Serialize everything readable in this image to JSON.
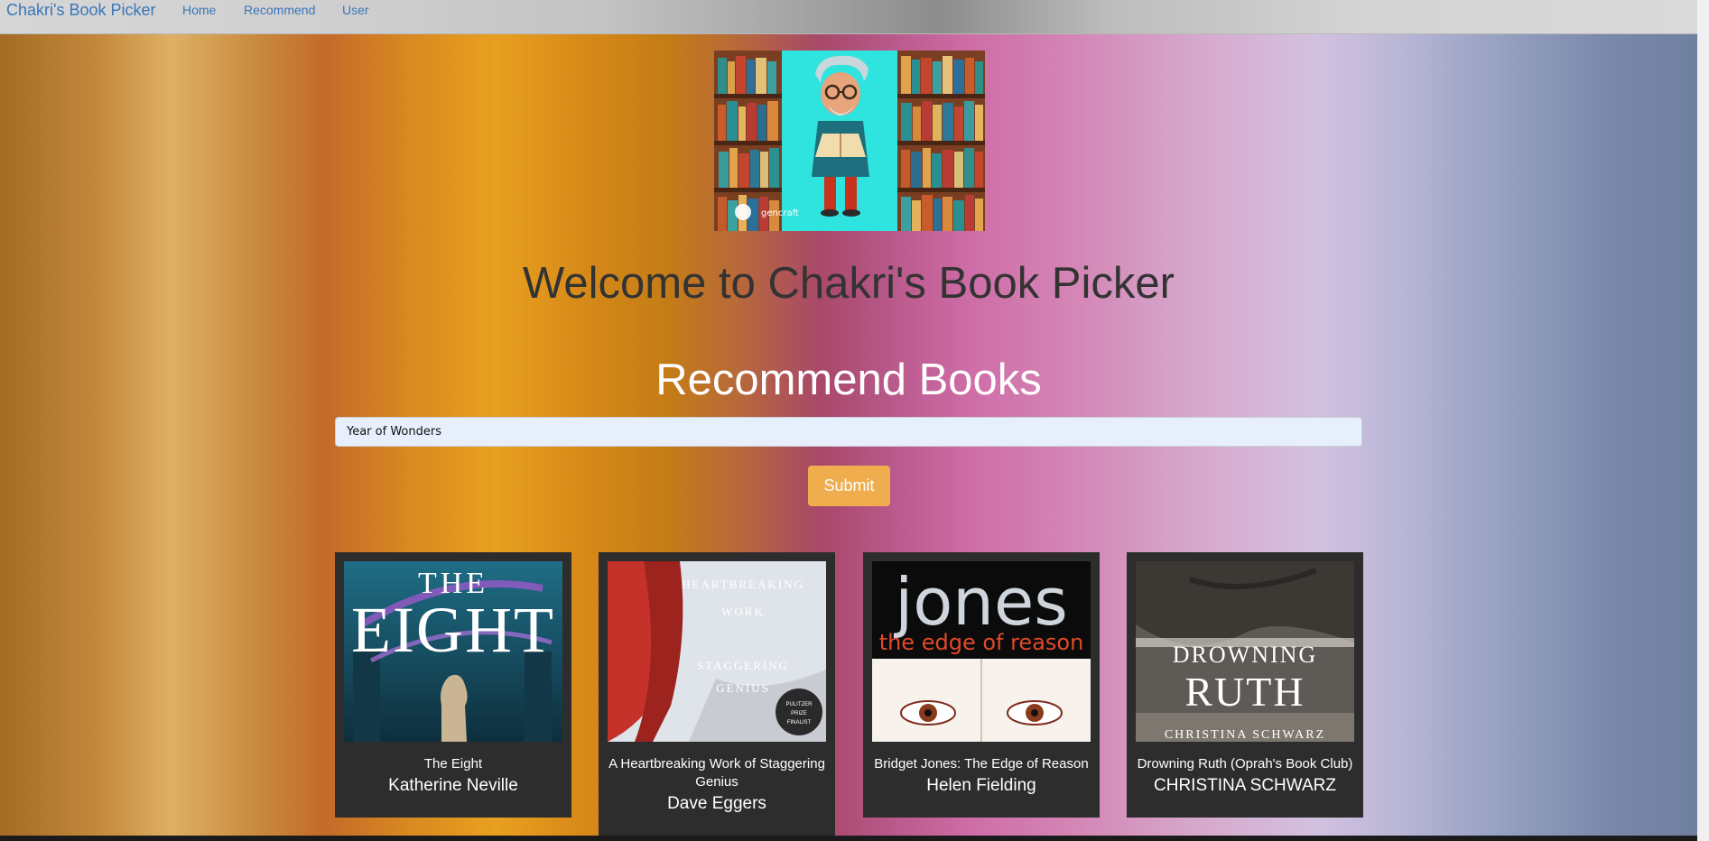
{
  "navbar": {
    "brand": "Chakri's Book Picker",
    "links": [
      "Home",
      "Recommend",
      "User"
    ]
  },
  "hero": {
    "watermark": "gencraft"
  },
  "welcome_title": "Welcome to Chakri's Book Picker",
  "recommend": {
    "title": "Recommend Books",
    "input_value": "Year of Wonders",
    "submit_label": "Submit"
  },
  "books": [
    {
      "title": "The Eight",
      "author": "Katherine Neville",
      "cover_text": "THE EIGHT"
    },
    {
      "title": "A Heartbreaking Work of Staggering Genius",
      "author": "Dave Eggers",
      "cover_text": "A HEARTBREAKING WORK OF STAGGERING GENIUS"
    },
    {
      "title": "Bridget Jones: The Edge of Reason",
      "author": "Helen Fielding",
      "cover_text": "jones the edge of reason"
    },
    {
      "title": "Drowning Ruth (Oprah's Book Club)",
      "author": "CHRISTINA SCHWARZ",
      "cover_text": "DROWNING RUTH"
    }
  ],
  "colors": {
    "brand_link": "#3a76b8",
    "submit": "#f0ad4e",
    "card_bg": "#2d2d2d",
    "input_bg": "#e8effc"
  }
}
